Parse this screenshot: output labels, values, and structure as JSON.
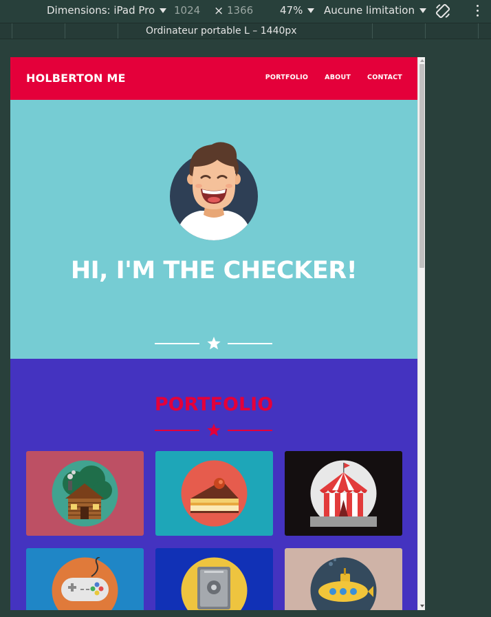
{
  "devtools": {
    "device_label": "Dimensions: iPad Pro",
    "width": "1024",
    "height": "1366",
    "zoom": "47%",
    "throttling": "Aucune limitation",
    "breakpoint_label": "Ordinateur portable L – 1440px",
    "icons": [
      "rotate-icon",
      "more-options-icon"
    ]
  },
  "site": {
    "brand": "HOLBERTON ME",
    "nav": [
      "PORTFOLIO",
      "ABOUT",
      "CONTACT"
    ],
    "hero_title": "HI, I'M THE CHECKER!",
    "portfolio_title": "PORTFOLIO",
    "cards": [
      {
        "name": "cabin",
        "bg": "#bd5064"
      },
      {
        "name": "cake",
        "bg": "#1ea6b8"
      },
      {
        "name": "circus",
        "bg": "#140f10"
      },
      {
        "name": "game-controller",
        "bg": "#1f86c6"
      },
      {
        "name": "safe",
        "bg": "#1131b6"
      },
      {
        "name": "submarine",
        "bg": "#cfb3a7"
      }
    ]
  },
  "colors": {
    "nav": "#e4003a",
    "hero": "#76ccd3",
    "portfolio": "#4433c0",
    "accent": "#e4003a"
  }
}
